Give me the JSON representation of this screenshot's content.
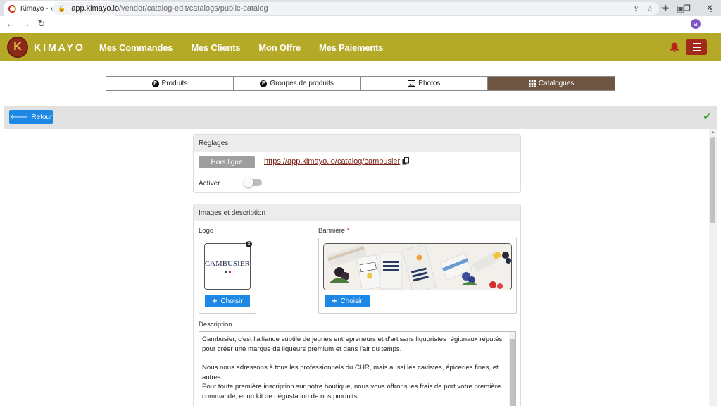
{
  "browser": {
    "tab_title": "Kimayo - Vente et prise de comm",
    "url_host": "app.kimayo.io",
    "url_path": "/vendor/catalog-edit/catalogs/public-catalog",
    "avatar_letter": "a"
  },
  "app": {
    "brand": "KIMAYO",
    "logo_letter": "K",
    "menu": [
      {
        "label": "Mes Commandes"
      },
      {
        "label": "Mes Clients"
      },
      {
        "label": "Mon Offre"
      },
      {
        "label": "Mes Paiements"
      }
    ],
    "colors": {
      "header": "#b5aa27",
      "accent": "#a12a1b",
      "primary": "#1e88e5",
      "active_tab": "#6f5643"
    }
  },
  "tabs": [
    {
      "label": "Produits",
      "icon": "p-circle-icon"
    },
    {
      "label": "Groupes de produits",
      "icon": "p-circle-icon"
    },
    {
      "label": "Photos",
      "icon": "image-icon"
    },
    {
      "label": "Catalogues",
      "icon": "grid-icon",
      "active": true
    }
  ],
  "actions": {
    "back_label": "Retour"
  },
  "settings": {
    "title": "Réglages",
    "status_badge": "Hors ligne",
    "catalog_link": "https://app.kimayo.io/catalog/cambusier",
    "activate_label": "Activer",
    "activated": false
  },
  "images": {
    "title": "Images et description",
    "logo_label": "Logo",
    "logo_brand": "CAMBUSIER",
    "banner_label": "Bannière",
    "required_mark": "*",
    "choose_label": "Choisir",
    "description_label": "Description",
    "description_paragraphs": [
      "Cambusier, c'est l'alliance subtile de jeunes entrepreneurs et d'artisans liquoristes régionaux réputés, pour créer une marque de liqueurs premium et dans l'air du temps.",
      "",
      "Nous nous adressons à tous les professionnels du CHR, mais aussi les cavistes,  épiceries fines, et autres.",
      "Pour toute première inscription sur notre boutique, nous vous offrons les frais de port votre première commande, et un kit de dégustation de nos produits."
    ]
  }
}
